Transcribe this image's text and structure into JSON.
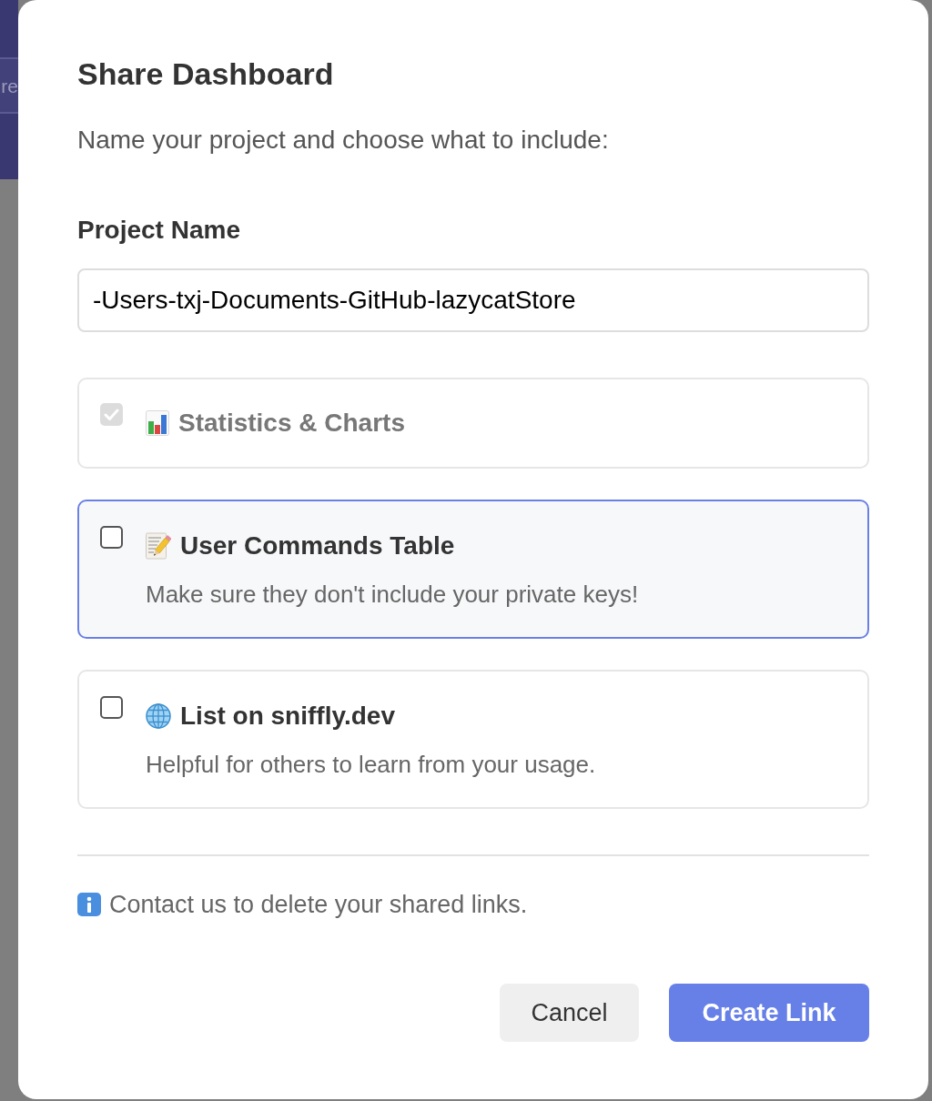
{
  "background": {
    "header_button": {
      "label": "re"
    }
  },
  "dialog": {
    "title": "Share Dashboard",
    "subtitle": "Name your project and choose what to include:",
    "project_name": {
      "label": "Project Name",
      "value": "-Users-txj-Documents-GitHub-lazycatStore"
    },
    "options": [
      {
        "title": "Statistics & Charts",
        "checked": true,
        "disabled": true,
        "focused": false
      },
      {
        "title": "User Commands Table",
        "description": "Make sure they don't include your private keys!",
        "checked": false,
        "disabled": false,
        "focused": true
      },
      {
        "title": "List on sniffly.dev",
        "description": "Helpful for others to learn from your usage.",
        "checked": false,
        "disabled": false,
        "focused": false
      }
    ],
    "note": "Contact us to delete your shared links.",
    "buttons": [
      {
        "label": "Cancel",
        "kind": "secondary"
      },
      {
        "label": "Create Link",
        "kind": "primary"
      }
    ]
  }
}
